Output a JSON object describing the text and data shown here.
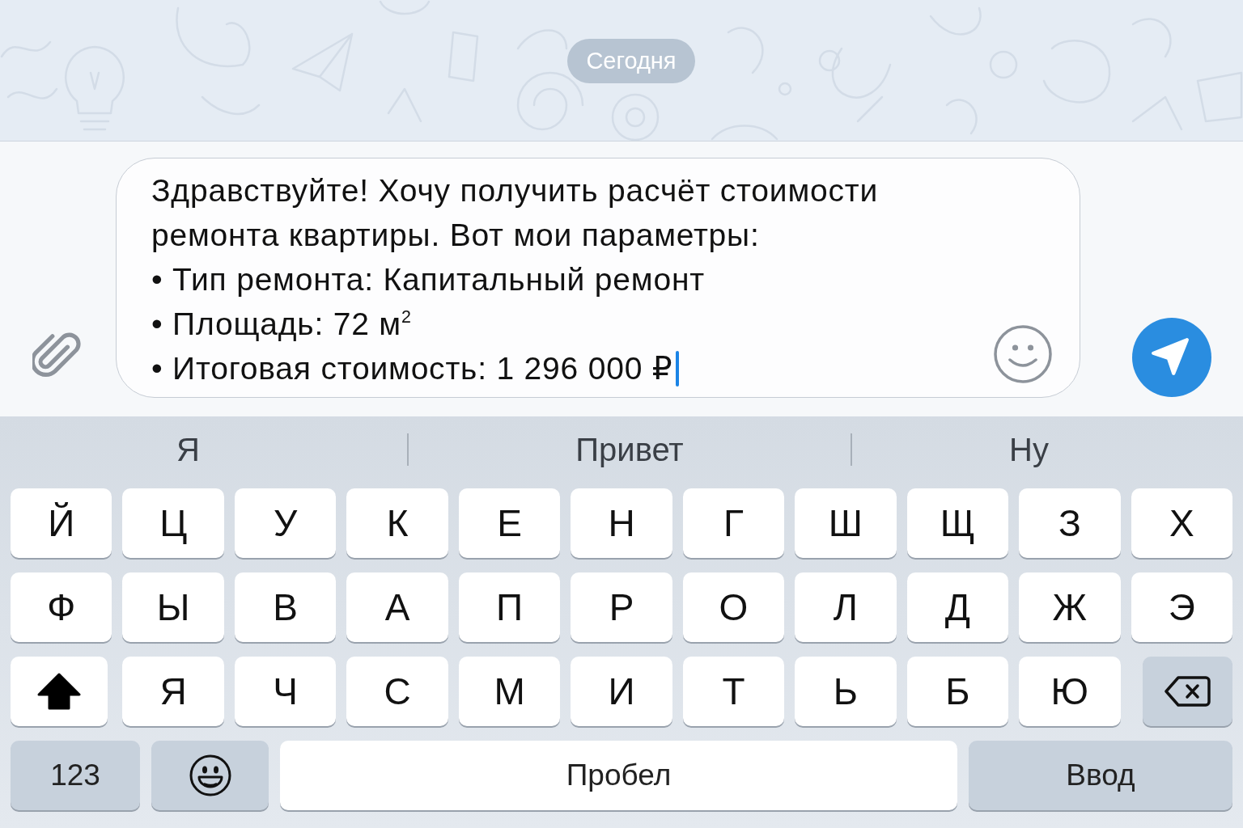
{
  "chat": {
    "date": "Сегодня"
  },
  "composer": {
    "value": "Здравствуйте! Хочу получить расчёт стоимости ремонта квартиры. Вот мои параметры:\n• Тип ремонта: Капитальный ремонт\n• Площадь: 72 м$^{2}$\n• Итоговая стоимость: 1 296 000 ₽",
    "focused": true
  },
  "keyboard": {
    "suggestions": [
      "Я",
      "Привет",
      "Ну"
    ],
    "rows": [
      {
        "kind": "letters",
        "keys": [
          {
            "kind": "letter",
            "label": "Й"
          },
          {
            "kind": "letter",
            "label": "Ц"
          },
          {
            "kind": "letter",
            "label": "У"
          },
          {
            "kind": "letter",
            "label": "К"
          },
          {
            "kind": "letter",
            "label": "Е"
          },
          {
            "kind": "letter",
            "label": "Н"
          },
          {
            "kind": "letter",
            "label": "Г"
          },
          {
            "kind": "letter",
            "label": "Ш"
          },
          {
            "kind": "letter",
            "label": "Щ"
          },
          {
            "kind": "letter",
            "label": "З"
          },
          {
            "kind": "letter",
            "label": "Х"
          }
        ]
      },
      {
        "kind": "letters",
        "keys": [
          {
            "kind": "letter",
            "label": "Ф"
          },
          {
            "kind": "letter",
            "label": "Ы"
          },
          {
            "kind": "letter",
            "label": "В"
          },
          {
            "kind": "letter",
            "label": "А"
          },
          {
            "kind": "letter",
            "label": "П"
          },
          {
            "kind": "letter",
            "label": "Р"
          },
          {
            "kind": "letter",
            "label": "О"
          },
          {
            "kind": "letter",
            "label": "Л"
          },
          {
            "kind": "letter",
            "label": "Д"
          },
          {
            "kind": "letter",
            "label": "Ж"
          },
          {
            "kind": "letter",
            "label": "Э"
          }
        ]
      },
      {
        "kind": "letters",
        "keys": [
          {
            "kind": "shift",
            "on": true
          },
          {
            "kind": "letter",
            "label": "Я"
          },
          {
            "kind": "letter",
            "label": "Ч"
          },
          {
            "kind": "letter",
            "label": "С"
          },
          {
            "kind": "letter",
            "label": "М"
          },
          {
            "kind": "letter",
            "label": "И"
          },
          {
            "kind": "letter",
            "label": "Т"
          },
          {
            "kind": "letter",
            "label": "Ь"
          },
          {
            "kind": "letter",
            "label": "Б"
          },
          {
            "kind": "letter",
            "label": "Ю"
          },
          {
            "kind": "backspace"
          }
        ]
      },
      {
        "kind": "controls",
        "keys": [
          {
            "kind": "mode",
            "label": "123"
          },
          {
            "kind": "emoji"
          },
          {
            "kind": "space",
            "label": "Пробел"
          },
          {
            "kind": "enter",
            "label": "Ввод"
          }
        ]
      }
    ]
  }
}
